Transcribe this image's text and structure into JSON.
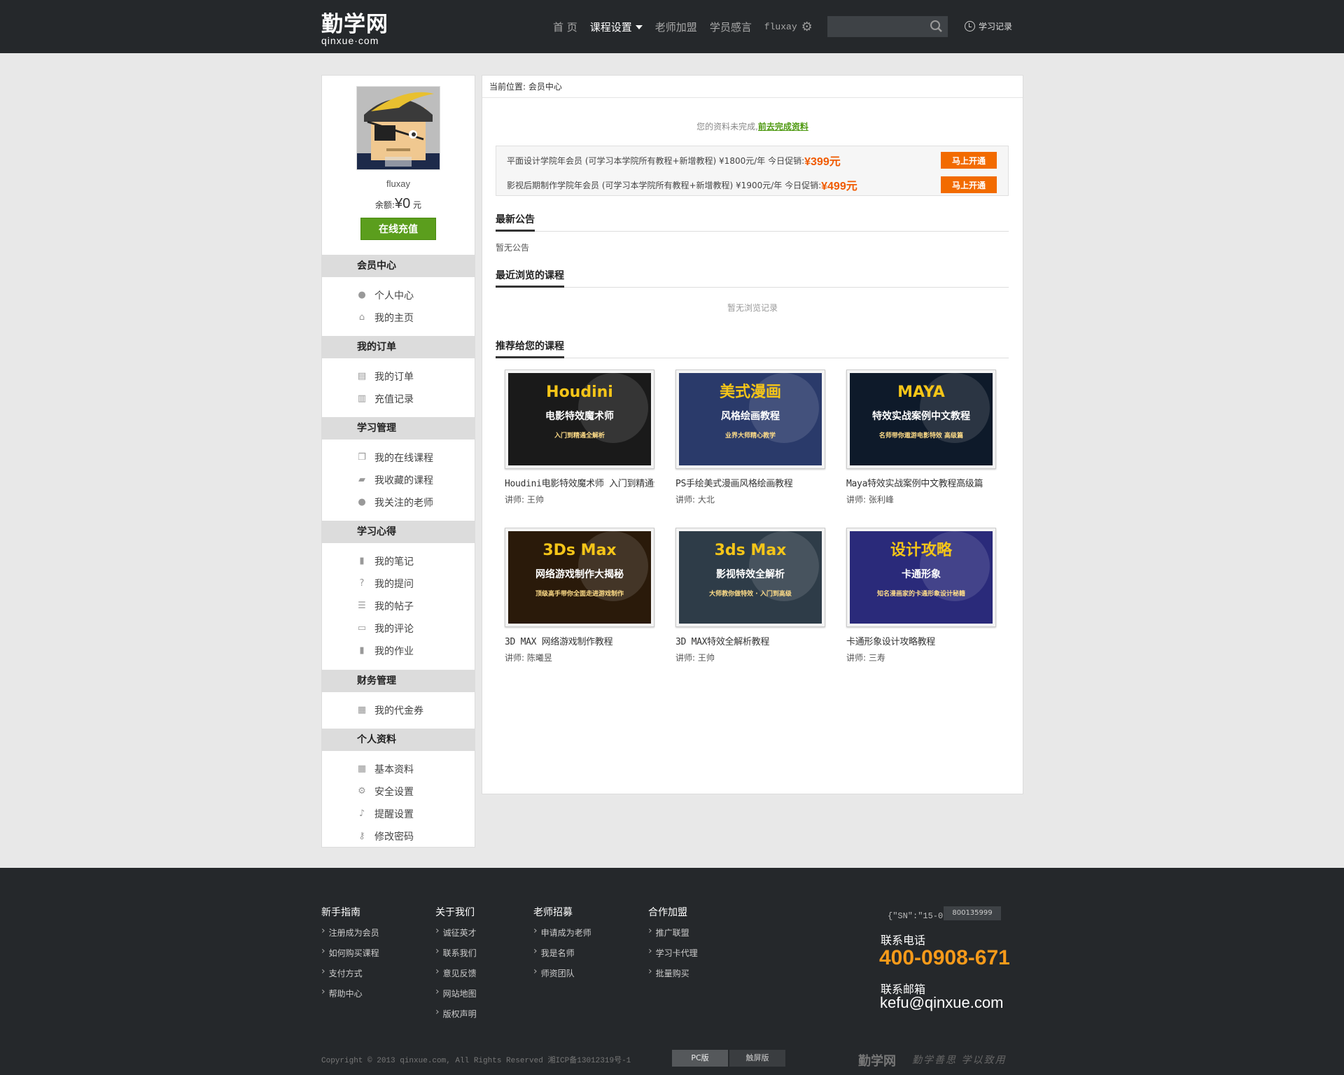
{
  "header": {
    "logo_zh": "勤学网",
    "logo_en": "qinxue·com",
    "nav": [
      "首 页",
      "课程设置",
      "老师加盟",
      "学员感言"
    ],
    "username": "fluxay",
    "search_placeholder": "",
    "history_label": "学习记录",
    "icons": {
      "search": "search-icon",
      "gear": "gear-icon",
      "clock": "clock-icon"
    }
  },
  "sidebar": {
    "username": "fluxay",
    "balance_label": "余额:",
    "balance_value": "¥0",
    "balance_unit": "元",
    "recharge_label": "在线充值",
    "sections": [
      {
        "title": "会员中心",
        "items": [
          "个人中心",
          "我的主页"
        ]
      },
      {
        "title": "我的订单",
        "items": [
          "我的订单",
          "充值记录"
        ]
      },
      {
        "title": "学习管理",
        "items": [
          "我的在线课程",
          "我收藏的课程",
          "我关注的老师"
        ]
      },
      {
        "title": "学习心得",
        "items": [
          "我的笔记",
          "我的提问",
          "我的帖子",
          "我的评论",
          "我的作业"
        ]
      },
      {
        "title": "财务管理",
        "items": [
          "我的代金券"
        ]
      },
      {
        "title": "个人资料",
        "items": [
          "基本资料",
          "安全设置",
          "提醒设置",
          "修改密码"
        ]
      }
    ]
  },
  "main": {
    "breadcrumb": "当前位置: 会员中心",
    "notice_text": "您的资料未完成,",
    "notice_link": "前去完成资料",
    "promos": [
      {
        "text": "平面设计学院年会员 (可学习本学院所有教程+新增教程) ¥1800元/年  今日促销:",
        "price": "¥399元",
        "button": "马上开通"
      },
      {
        "text": "影视后期制作学院年会员 (可学习本学院所有教程+新增教程) ¥1900元/年  今日促销:",
        "price": "¥499元",
        "button": "马上开通"
      }
    ],
    "announce_title": "最新公告",
    "announce_empty": "暂无公告",
    "recent_title": "最近浏览的课程",
    "recent_empty": "暂无浏览记录",
    "recommend_title": "推荐给您的课程",
    "courses": [
      {
        "title": "Houdini电影特效魔术师 入门到精通全解析",
        "lecturer": "讲师: 王帅",
        "thumb": [
          "Houdini",
          "电影特效魔术师",
          "入门到精通全解析"
        ],
        "color": "#1a1a1a"
      },
      {
        "title": "PS手绘美式漫画风格绘画教程",
        "lecturer": "讲师: 大北",
        "thumb": [
          "美式漫画",
          "风格绘画教程",
          "业界大师精心教学"
        ],
        "color": "#2a3a6a"
      },
      {
        "title": "Maya特效实战案例中文教程高级篇",
        "lecturer": "讲师: 张利峰",
        "thumb": [
          "MAYA",
          "特效实战案例中文教程",
          "名师带你遨游电影特效 高级篇"
        ],
        "color": "#0e1a2a"
      },
      {
        "title": "3D MAX 网络游戏制作教程",
        "lecturer": "讲师: 陈曦昱",
        "thumb": [
          "3Ds Max",
          "网络游戏制作大揭秘",
          "顶级高手带你全面走进游戏制作"
        ],
        "color": "#2a1a0a"
      },
      {
        "title": "3D MAX特效全解析教程",
        "lecturer": "讲师: 王帅",
        "thumb": [
          "3ds Max",
          "影视特效全解析",
          "大师教你做特效 · 入门到高级"
        ],
        "color": "#2e3c48"
      },
      {
        "title": "卡通形象设计攻略教程",
        "lecturer": "讲师: 三寿",
        "thumb": [
          "设计攻略",
          "卡通形象",
          "知名漫画家的卡通形象设计秘籍"
        ],
        "color": "#2a2a7a"
      }
    ]
  },
  "footer": {
    "columns": [
      {
        "title": "新手指南",
        "links": [
          "注册成为会员",
          "如何购买课程",
          "支付方式",
          "帮助中心"
        ]
      },
      {
        "title": "关于我们",
        "links": [
          "诚征英才",
          "联系我们",
          "意见反馈",
          "网站地图",
          "版权声明"
        ]
      },
      {
        "title": "老师招募",
        "links": [
          "申请成为老师",
          "我是名师",
          "师资团队"
        ]
      },
      {
        "title": "合作加盟",
        "links": [
          "推广联盟",
          "学习卡代理",
          "批量购买"
        ]
      }
    ],
    "sn_text": "{\"SN\":\"15-0",
    "sn_box": "800135999",
    "phone_label": "联系电话",
    "phone": "400-0908-671",
    "email_label": "联系邮箱",
    "email": "kefu@qinxue.com",
    "copyright": "Copyright © 2013 qinxue.com, All Rights Reserved 湘ICP备13012319号-1",
    "versions": [
      "PC版",
      "触屏版"
    ],
    "footer_logo": "勤学网",
    "slogan": "勤学善思 学以致用"
  },
  "colors": {
    "accent_green": "#5b9e1d",
    "promo_orange": "#f26b00",
    "phone_orange": "#f79a1a",
    "header_bg": "#25282b"
  }
}
